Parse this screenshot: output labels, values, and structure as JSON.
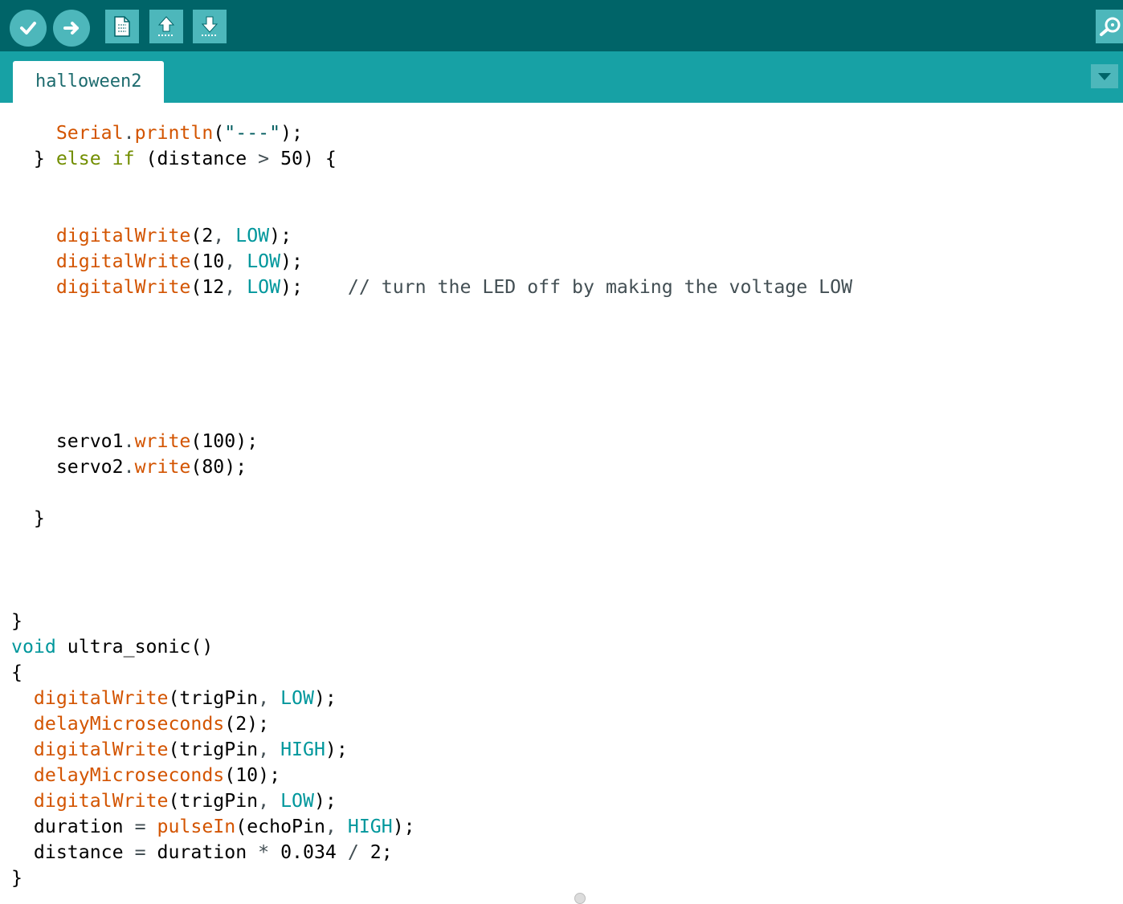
{
  "toolbar": {
    "buttons": [
      {
        "name": "verify-button",
        "icon": "checkmark-icon"
      },
      {
        "name": "upload-button",
        "icon": "arrow-right-icon"
      },
      {
        "name": "new-button",
        "icon": "document-icon"
      },
      {
        "name": "open-button",
        "icon": "arrow-up-icon"
      },
      {
        "name": "save-button",
        "icon": "arrow-down-icon"
      },
      {
        "name": "serial-monitor-button",
        "icon": "magnifier-icon"
      }
    ]
  },
  "tabs": [
    {
      "label": "halloween2",
      "active": true
    }
  ],
  "tab_menu_icon": "triangle-down-icon",
  "colors": {
    "toolbar": "#006468",
    "tabbar": "#17a1a5",
    "button": "#4db7bb",
    "function": "#d35400",
    "constant": "#00979c",
    "keyword": "#728e00",
    "comment": "#434f54"
  },
  "editor": {
    "lines": [
      [
        {
          "t": "    "
        },
        {
          "t": "Serial",
          "c": "fn"
        },
        {
          "t": ".",
          "c": "op"
        },
        {
          "t": "println",
          "c": "fn"
        },
        {
          "t": "("
        },
        {
          "t": "\"---\"",
          "c": "str"
        },
        {
          "t": ");"
        }
      ],
      [
        {
          "t": "  } "
        },
        {
          "t": "else",
          "c": "kw"
        },
        {
          "t": " "
        },
        {
          "t": "if",
          "c": "kw"
        },
        {
          "t": " (distance "
        },
        {
          "t": ">",
          "c": "op"
        },
        {
          "t": " 50) {"
        }
      ],
      [],
      [],
      [
        {
          "t": "    "
        },
        {
          "t": "digitalWrite",
          "c": "fn"
        },
        {
          "t": "(2"
        },
        {
          "t": ",",
          "c": "op"
        },
        {
          "t": " "
        },
        {
          "t": "LOW",
          "c": "const"
        },
        {
          "t": ");"
        }
      ],
      [
        {
          "t": "    "
        },
        {
          "t": "digitalWrite",
          "c": "fn"
        },
        {
          "t": "(10"
        },
        {
          "t": ",",
          "c": "op"
        },
        {
          "t": " "
        },
        {
          "t": "LOW",
          "c": "const"
        },
        {
          "t": ");"
        }
      ],
      [
        {
          "t": "    "
        },
        {
          "t": "digitalWrite",
          "c": "fn"
        },
        {
          "t": "(12"
        },
        {
          "t": ",",
          "c": "op"
        },
        {
          "t": " "
        },
        {
          "t": "LOW",
          "c": "const"
        },
        {
          "t": ");    "
        },
        {
          "t": "// turn the LED off by making the voltage LOW",
          "c": "cmt"
        }
      ],
      [],
      [],
      [],
      [],
      [],
      [
        {
          "t": "    servo1"
        },
        {
          "t": ".",
          "c": "op"
        },
        {
          "t": "write",
          "c": "fn"
        },
        {
          "t": "(100);"
        }
      ],
      [
        {
          "t": "    servo2"
        },
        {
          "t": ".",
          "c": "op"
        },
        {
          "t": "write",
          "c": "fn"
        },
        {
          "t": "(80);"
        }
      ],
      [],
      [
        {
          "t": "  }"
        }
      ],
      [],
      [],
      [],
      [
        {
          "t": "}"
        }
      ],
      [
        {
          "t": "void",
          "c": "type"
        },
        {
          "t": " ultra_sonic()"
        }
      ],
      [
        {
          "t": "{"
        }
      ],
      [
        {
          "t": "  "
        },
        {
          "t": "digitalWrite",
          "c": "fn"
        },
        {
          "t": "(trigPin"
        },
        {
          "t": ",",
          "c": "op"
        },
        {
          "t": " "
        },
        {
          "t": "LOW",
          "c": "const"
        },
        {
          "t": ");"
        }
      ],
      [
        {
          "t": "  "
        },
        {
          "t": "delayMicroseconds",
          "c": "fn"
        },
        {
          "t": "(2);"
        }
      ],
      [
        {
          "t": "  "
        },
        {
          "t": "digitalWrite",
          "c": "fn"
        },
        {
          "t": "(trigPin"
        },
        {
          "t": ",",
          "c": "op"
        },
        {
          "t": " "
        },
        {
          "t": "HIGH",
          "c": "const"
        },
        {
          "t": ");"
        }
      ],
      [
        {
          "t": "  "
        },
        {
          "t": "delayMicroseconds",
          "c": "fn"
        },
        {
          "t": "(10);"
        }
      ],
      [
        {
          "t": "  "
        },
        {
          "t": "digitalWrite",
          "c": "fn"
        },
        {
          "t": "(trigPin"
        },
        {
          "t": ",",
          "c": "op"
        },
        {
          "t": " "
        },
        {
          "t": "LOW",
          "c": "const"
        },
        {
          "t": ");"
        }
      ],
      [
        {
          "t": "  duration "
        },
        {
          "t": "=",
          "c": "op"
        },
        {
          "t": " "
        },
        {
          "t": "pulseIn",
          "c": "fn"
        },
        {
          "t": "(echoPin"
        },
        {
          "t": ",",
          "c": "op"
        },
        {
          "t": " "
        },
        {
          "t": "HIGH",
          "c": "const"
        },
        {
          "t": ");"
        }
      ],
      [
        {
          "t": "  distance "
        },
        {
          "t": "=",
          "c": "op"
        },
        {
          "t": " duration "
        },
        {
          "t": "*",
          "c": "op"
        },
        {
          "t": " 0.034 "
        },
        {
          "t": "/",
          "c": "op"
        },
        {
          "t": " 2;"
        }
      ],
      [
        {
          "t": "}"
        }
      ]
    ]
  }
}
